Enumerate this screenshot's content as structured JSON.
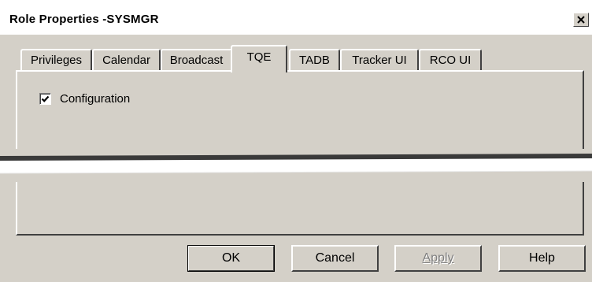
{
  "window": {
    "title": "Role Properties -SYSMGR",
    "close_glyph": "✕"
  },
  "tabs": [
    {
      "label": "Privileges",
      "active": false
    },
    {
      "label": "Calendar",
      "active": false
    },
    {
      "label": "Broadcast",
      "active": false
    },
    {
      "label": "TQE",
      "active": true
    },
    {
      "label": "TADB",
      "active": false
    },
    {
      "label": "Tracker UI",
      "active": false
    },
    {
      "label": "RCO UI",
      "active": false
    }
  ],
  "tqe_panel": {
    "checkbox": {
      "label": "Configuration",
      "checked": true
    }
  },
  "buttons": {
    "ok": "OK",
    "cancel": "Cancel",
    "apply": "Apply",
    "help": "Help"
  },
  "colors": {
    "face": "#d4d0c8",
    "highlight": "#ffffff",
    "shadow": "#404040",
    "disabled_text": "#808080"
  }
}
